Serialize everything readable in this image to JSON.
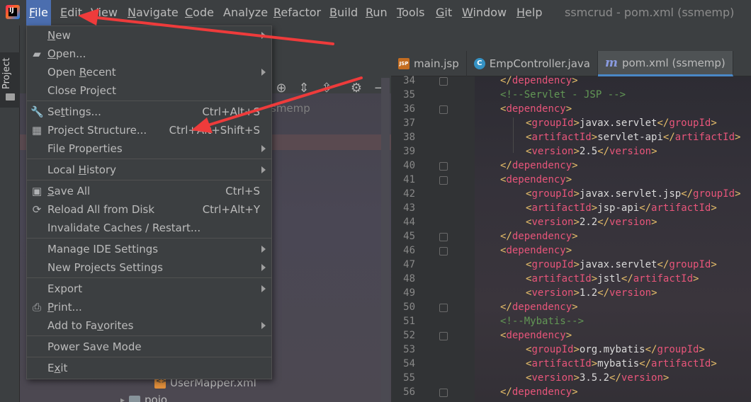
{
  "menubar": {
    "items": [
      {
        "label": "File",
        "mnemonic": "F",
        "rest": "ile"
      },
      {
        "label": "Edit",
        "mnemonic": "E",
        "rest": "dit"
      },
      {
        "label": "View",
        "mnemonic": "V",
        "rest": "iew"
      },
      {
        "label": "Navigate",
        "mnemonic": "N",
        "rest": "avigate"
      },
      {
        "label": "Code",
        "mnemonic": "C",
        "rest": "ode"
      },
      {
        "label": "Analyze",
        "mnemonic": "",
        "rest": "Analyze"
      },
      {
        "label": "Refactor",
        "mnemonic": "R",
        "rest": "efactor"
      },
      {
        "label": "Build",
        "mnemonic": "B",
        "rest": "uild"
      },
      {
        "label": "Run",
        "mnemonic": "R",
        "rest": "un"
      },
      {
        "label": "Tools",
        "mnemonic": "T",
        "rest": "ools"
      },
      {
        "label": "Git",
        "mnemonic": "G",
        "rest": "it"
      },
      {
        "label": "Window",
        "mnemonic": "W",
        "rest": "indow"
      },
      {
        "label": "Help",
        "mnemonic": "H",
        "rest": "elp"
      }
    ],
    "window_title": "ssmcrud - pom.xml (ssmemp)"
  },
  "left_strip": {
    "project_label": "Project"
  },
  "project_panel": {
    "title": "ssm",
    "tree_hint": "smemp",
    "usermapper": "UserMapper.xml",
    "pojo": "pojo"
  },
  "file_menu": {
    "items": [
      {
        "pre": "",
        "mn": "N",
        "post": "ew",
        "shortcut": "",
        "submenu": true,
        "icon": ""
      },
      {
        "pre": "",
        "mn": "O",
        "post": "pen...",
        "shortcut": "",
        "submenu": false,
        "icon": "folder-open-icon"
      },
      {
        "pre": "Open ",
        "mn": "R",
        "post": "ecent",
        "shortcut": "",
        "submenu": true,
        "icon": ""
      },
      {
        "pre": "Close Project",
        "mn": "",
        "post": "",
        "shortcut": "",
        "submenu": false,
        "icon": ""
      },
      {
        "pre": "Se",
        "mn": "t",
        "post": "tings...",
        "shortcut": "Ctrl+Alt+S",
        "submenu": false,
        "icon": "wrench-icon"
      },
      {
        "pre": "Project Structure...",
        "mn": "",
        "post": "",
        "shortcut": "Ctrl+Alt+Shift+S",
        "submenu": false,
        "icon": "project-structure-icon"
      },
      {
        "pre": "File Properties",
        "mn": "",
        "post": "",
        "shortcut": "",
        "submenu": true,
        "icon": ""
      },
      {
        "pre": "Local ",
        "mn": "H",
        "post": "istory",
        "shortcut": "",
        "submenu": true,
        "icon": ""
      },
      {
        "pre": "",
        "mn": "S",
        "post": "ave All",
        "shortcut": "Ctrl+S",
        "submenu": false,
        "icon": "save-icon"
      },
      {
        "pre": "Reload All from Disk",
        "mn": "",
        "post": "",
        "shortcut": "Ctrl+Alt+Y",
        "submenu": false,
        "icon": "reload-icon"
      },
      {
        "pre": "Invalidate Caches / Restart...",
        "mn": "",
        "post": "",
        "shortcut": "",
        "submenu": false,
        "icon": ""
      },
      {
        "pre": "Manage IDE Settings",
        "mn": "",
        "post": "",
        "shortcut": "",
        "submenu": true,
        "icon": ""
      },
      {
        "pre": "New Projects Settings",
        "mn": "",
        "post": "",
        "shortcut": "",
        "submenu": true,
        "icon": ""
      },
      {
        "pre": "Export",
        "mn": "",
        "post": "",
        "shortcut": "",
        "submenu": true,
        "icon": ""
      },
      {
        "pre": "",
        "mn": "P",
        "post": "rint...",
        "shortcut": "",
        "submenu": false,
        "icon": "print-icon"
      },
      {
        "pre": "Add to Fa",
        "mn": "v",
        "post": "orites",
        "shortcut": "",
        "submenu": true,
        "icon": ""
      },
      {
        "pre": "Power Save Mode",
        "mn": "",
        "post": "",
        "shortcut": "",
        "submenu": false,
        "icon": ""
      },
      {
        "pre": "E",
        "mn": "x",
        "post": "it",
        "shortcut": "",
        "submenu": false,
        "icon": ""
      }
    ]
  },
  "editor": {
    "tabs": [
      {
        "label": "main.jsp",
        "icon": "jsp-file-icon",
        "icon_text": "JSP"
      },
      {
        "label": "EmpController.java",
        "icon": "java-class-icon",
        "icon_text": "C"
      },
      {
        "label": "pom.xml (ssmemp)",
        "icon": "maven-icon",
        "icon_text": "m"
      }
    ],
    "lines": [
      {
        "n": "34",
        "parts": [
          [
            "br",
            "</"
          ],
          [
            "tag",
            "dependency"
          ],
          [
            "br",
            ">"
          ]
        ],
        "indent": 1
      },
      {
        "n": "35",
        "parts": [
          [
            "cm",
            "<!--Servlet - JSP -->"
          ]
        ],
        "indent": 1
      },
      {
        "n": "36",
        "parts": [
          [
            "br",
            "<"
          ],
          [
            "tag",
            "dependency"
          ],
          [
            "br",
            ">"
          ]
        ],
        "indent": 1
      },
      {
        "n": "37",
        "parts": [
          [
            "br",
            "<"
          ],
          [
            "tag",
            "groupId"
          ],
          [
            "br",
            ">"
          ],
          [
            "txt",
            "javax.servlet"
          ],
          [
            "br",
            "</"
          ],
          [
            "tag",
            "groupId"
          ],
          [
            "br",
            ">"
          ]
        ],
        "indent": 2
      },
      {
        "n": "38",
        "parts": [
          [
            "br",
            "<"
          ],
          [
            "tag",
            "artifactId"
          ],
          [
            "br",
            ">"
          ],
          [
            "txt",
            "servlet-api"
          ],
          [
            "br",
            "</"
          ],
          [
            "tag",
            "artifactId"
          ],
          [
            "br",
            ">"
          ]
        ],
        "indent": 2
      },
      {
        "n": "39",
        "parts": [
          [
            "br",
            "<"
          ],
          [
            "tag",
            "version"
          ],
          [
            "br",
            ">"
          ],
          [
            "txt",
            "2.5"
          ],
          [
            "br",
            "</"
          ],
          [
            "tag",
            "version"
          ],
          [
            "br",
            ">"
          ]
        ],
        "indent": 2
      },
      {
        "n": "40",
        "parts": [
          [
            "br",
            "</"
          ],
          [
            "tag",
            "dependency"
          ],
          [
            "br",
            ">"
          ]
        ],
        "indent": 1
      },
      {
        "n": "41",
        "parts": [
          [
            "br",
            "<"
          ],
          [
            "tag",
            "dependency"
          ],
          [
            "br",
            ">"
          ]
        ],
        "indent": 1
      },
      {
        "n": "42",
        "parts": [
          [
            "br",
            "<"
          ],
          [
            "tag",
            "groupId"
          ],
          [
            "br",
            ">"
          ],
          [
            "txt",
            "javax.servlet.jsp"
          ],
          [
            "br",
            "</"
          ],
          [
            "tag",
            "groupId"
          ],
          [
            "br",
            ">"
          ]
        ],
        "indent": 2
      },
      {
        "n": "43",
        "parts": [
          [
            "br",
            "<"
          ],
          [
            "tag",
            "artifactId"
          ],
          [
            "br",
            ">"
          ],
          [
            "txt",
            "jsp-api"
          ],
          [
            "br",
            "</"
          ],
          [
            "tag",
            "artifactId"
          ],
          [
            "br",
            ">"
          ]
        ],
        "indent": 2
      },
      {
        "n": "44",
        "parts": [
          [
            "br",
            "<"
          ],
          [
            "tag",
            "version"
          ],
          [
            "br",
            ">"
          ],
          [
            "txt",
            "2.2"
          ],
          [
            "br",
            "</"
          ],
          [
            "tag",
            "version"
          ],
          [
            "br",
            ">"
          ]
        ],
        "indent": 2
      },
      {
        "n": "45",
        "parts": [
          [
            "br",
            "</"
          ],
          [
            "tag",
            "dependency"
          ],
          [
            "br",
            ">"
          ]
        ],
        "indent": 1
      },
      {
        "n": "46",
        "parts": [
          [
            "br",
            "<"
          ],
          [
            "tag",
            "dependency"
          ],
          [
            "br",
            ">"
          ]
        ],
        "indent": 1
      },
      {
        "n": "47",
        "parts": [
          [
            "br",
            "<"
          ],
          [
            "tag",
            "groupId"
          ],
          [
            "br",
            ">"
          ],
          [
            "txt",
            "javax.servlet"
          ],
          [
            "br",
            "</"
          ],
          [
            "tag",
            "groupId"
          ],
          [
            "br",
            ">"
          ]
        ],
        "indent": 2
      },
      {
        "n": "48",
        "parts": [
          [
            "br",
            "<"
          ],
          [
            "tag",
            "artifactId"
          ],
          [
            "br",
            ">"
          ],
          [
            "txt",
            "jstl"
          ],
          [
            "br",
            "</"
          ],
          [
            "tag",
            "artifactId"
          ],
          [
            "br",
            ">"
          ]
        ],
        "indent": 2
      },
      {
        "n": "49",
        "parts": [
          [
            "br",
            "<"
          ],
          [
            "tag",
            "version"
          ],
          [
            "br",
            ">"
          ],
          [
            "txt",
            "1.2"
          ],
          [
            "br",
            "</"
          ],
          [
            "tag",
            "version"
          ],
          [
            "br",
            ">"
          ]
        ],
        "indent": 2
      },
      {
        "n": "50",
        "parts": [
          [
            "br",
            "</"
          ],
          [
            "tag",
            "dependency"
          ],
          [
            "br",
            ">"
          ]
        ],
        "indent": 1
      },
      {
        "n": "51",
        "parts": [
          [
            "cm",
            "<!--Mybatis-->"
          ]
        ],
        "indent": 1
      },
      {
        "n": "52",
        "parts": [
          [
            "br",
            "<"
          ],
          [
            "tag",
            "dependency"
          ],
          [
            "br",
            ">"
          ]
        ],
        "indent": 1
      },
      {
        "n": "53",
        "parts": [
          [
            "br",
            "<"
          ],
          [
            "tag",
            "groupId"
          ],
          [
            "br",
            ">"
          ],
          [
            "txt",
            "org.mybatis"
          ],
          [
            "br",
            "</"
          ],
          [
            "tag",
            "groupId"
          ],
          [
            "br",
            ">"
          ]
        ],
        "indent": 2
      },
      {
        "n": "54",
        "parts": [
          [
            "br",
            "<"
          ],
          [
            "tag",
            "artifactId"
          ],
          [
            "br",
            ">"
          ],
          [
            "txt",
            "mybatis"
          ],
          [
            "br",
            "</"
          ],
          [
            "tag",
            "artifactId"
          ],
          [
            "br",
            ">"
          ]
        ],
        "indent": 2
      },
      {
        "n": "55",
        "parts": [
          [
            "br",
            "<"
          ],
          [
            "tag",
            "version"
          ],
          [
            "br",
            ">"
          ],
          [
            "txt",
            "3.5.2"
          ],
          [
            "br",
            "</"
          ],
          [
            "tag",
            "version"
          ],
          [
            "br",
            ">"
          ]
        ],
        "indent": 2
      },
      {
        "n": "56",
        "parts": [
          [
            "br",
            "</"
          ],
          [
            "tag",
            "dependency"
          ],
          [
            "br",
            ">"
          ]
        ],
        "indent": 1
      }
    ]
  },
  "colors": {
    "menu_active": "#4b6eaf",
    "annotation_arrow": "#ee3b3b",
    "xml_tag": "#e8557a",
    "xml_bracket": "#e8bf6a",
    "xml_comment": "#629755"
  }
}
